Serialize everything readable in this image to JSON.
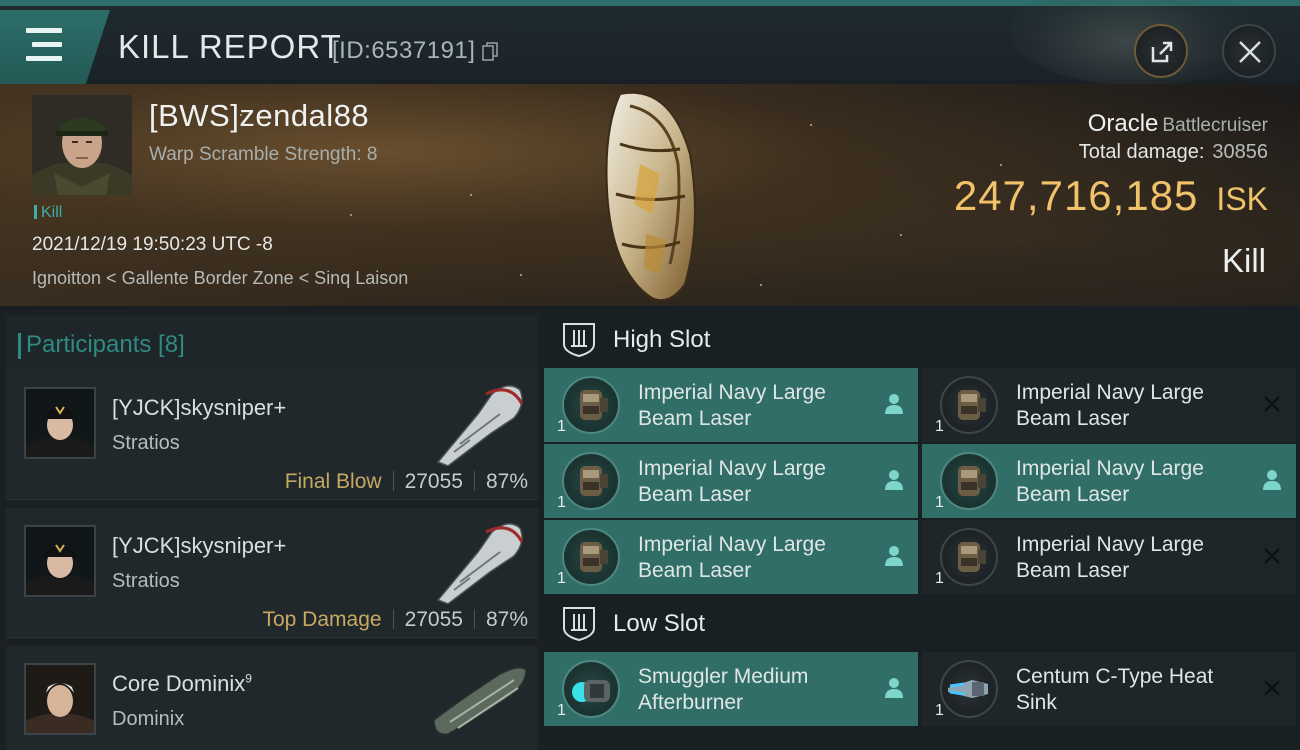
{
  "header": {
    "title": "KILL REPORT",
    "id_label": "[ID:6537191]"
  },
  "victim": {
    "name": "[BWS]zendal88",
    "detail": "Warp Scramble Strength: 8",
    "tag": "Kill",
    "datetime": "2021/12/19 19:50:23 UTC -8",
    "location": "Ignoitton < Gallente Border Zone < Sinq Laison",
    "ship_name": "Oracle",
    "ship_class": "Battlecruiser",
    "damage_label": "Total damage:",
    "damage_value": "30856",
    "isk_value": "247,716,185",
    "isk_unit": "ISK",
    "result": "Kill"
  },
  "participants": {
    "header": "Participants [8]",
    "rows": [
      {
        "name": "[YJCK]skysniper+",
        "sup": "",
        "ship": "Stratios",
        "label": "Final Blow",
        "damage": "27055",
        "percent": "87%"
      },
      {
        "name": "[YJCK]skysniper+",
        "sup": "",
        "ship": "Stratios",
        "label": "Top Damage",
        "damage": "27055",
        "percent": "87%"
      },
      {
        "name": "Core Dominix",
        "sup": "9",
        "ship": "Dominix",
        "label": "",
        "damage": "",
        "percent": ""
      }
    ]
  },
  "fitting": {
    "high_slot_title": "High Slot",
    "low_slot_title": "Low Slot",
    "high_slot": [
      {
        "name_1": "Imperial Navy Large",
        "name_2": "Beam Laser",
        "qty": "1",
        "status": "dropped"
      },
      {
        "name_1": "Imperial Navy Large",
        "name_2": "Beam Laser",
        "qty": "1",
        "status": "destroyed"
      },
      {
        "name_1": "Imperial Navy Large",
        "name_2": "Beam Laser",
        "qty": "1",
        "status": "dropped"
      },
      {
        "name_1": "Imperial Navy Large",
        "name_2": "Beam Laser",
        "qty": "1",
        "status": "dropped"
      },
      {
        "name_1": "Imperial Navy Large",
        "name_2": "Beam Laser",
        "qty": "1",
        "status": "dropped"
      },
      {
        "name_1": "Imperial Navy Large",
        "name_2": "Beam Laser",
        "qty": "1",
        "status": "destroyed"
      }
    ],
    "low_slot": [
      {
        "name_1": "Smuggler Medium",
        "name_2": "Afterburner",
        "qty": "1",
        "status": "dropped"
      },
      {
        "name_1": "Centum C-Type Heat",
        "name_2": "Sink",
        "qty": "1",
        "status": "destroyed"
      }
    ]
  },
  "colors": {
    "accent_teal": "#316e68",
    "isk_gold": "#f0c36a",
    "final_blow_gold": "#c7a862"
  },
  "icons": [
    "menu-icon",
    "copy-icon",
    "share-icon",
    "close-icon",
    "slot-icon",
    "person-icon",
    "destroyed-x-icon"
  ]
}
